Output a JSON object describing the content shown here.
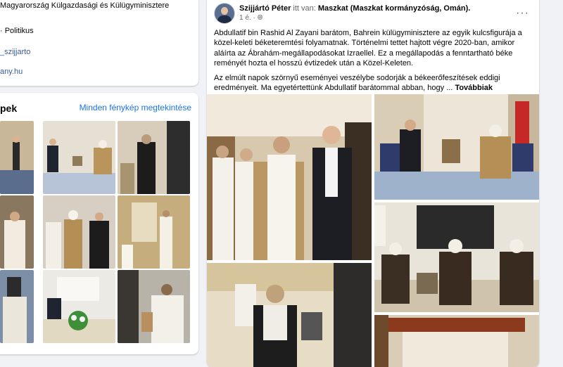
{
  "intro": {
    "line1": "Magyarország Külgazdasági és Külügyminisztere",
    "line2": "· Politikus",
    "line3": "_szijjarto",
    "line4": "any.hu"
  },
  "photos": {
    "title": "pek",
    "see_all": "Minden fénykép megtekintése"
  },
  "post": {
    "author": "Szijjártó Péter",
    "at_text": "itt van:",
    "location": "Maszkat (Maszkat kormányzóság, Omán).",
    "time": "1 é.",
    "privacy_icon": "globe-icon",
    "more_icon": "ellipsis-icon",
    "paragraph1": "Abdullatif bin Rashid Al Zayani barátom, Bahrein külügyminisztere az egyik kulcsfigurája a közel-keleti béketeremtési folyamatnak. Történelmi tettet hajtott végre 2020-ban, amikor aláírta az Ábrahám-megállapodásokat Izraellel. Ez a megállapodás a fenntartható béke reményét hozta el hosszú évtizedek után a Közel-Keleten.",
    "paragraph2": "Az elmúlt napok szörnyű eseményei veszélybe sodorják a békeerőfeszítések eddigi eredményeit. Ma egyetértettünk Abdullatif barátommal abban, hogy ...",
    "see_more": "Továbbiak"
  },
  "colors": {
    "background": "#f0f2f5",
    "card": "#ffffff",
    "link": "#385898",
    "accent": "#1b74e4",
    "muted": "#65676b"
  }
}
